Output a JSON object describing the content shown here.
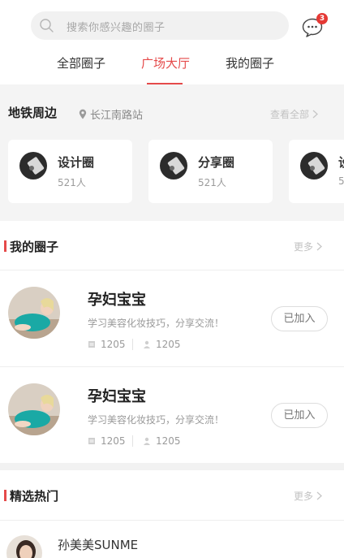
{
  "search": {
    "placeholder": "搜索你感兴趣的圈子"
  },
  "messages": {
    "badge_count": "3"
  },
  "tabs": [
    {
      "label": "全部圈子",
      "active": false
    },
    {
      "label": "广场大厅",
      "active": true
    },
    {
      "label": "我的圈子",
      "active": false
    }
  ],
  "nearby": {
    "title": "地铁周边",
    "location": "长江南路站",
    "more_label": "查看全部",
    "cards": [
      {
        "name": "设计圈",
        "count": "521人"
      },
      {
        "name": "分享圈",
        "count": "521人"
      },
      {
        "name": "设",
        "count": "5"
      }
    ]
  },
  "my_groups": {
    "title": "我的圈子",
    "more_label": "更多",
    "items": [
      {
        "name": "孕妇宝宝",
        "desc": "学习美容化妆技巧，分享交流！",
        "posts": "1205",
        "members": "1205",
        "button": "已加入"
      },
      {
        "name": "孕妇宝宝",
        "desc": "学习美容化妆技巧，分享交流！",
        "posts": "1205",
        "members": "1205",
        "button": "已加入"
      }
    ]
  },
  "hot": {
    "title": "精选热门",
    "more_label": "更多",
    "first_user": "孙美美SUNME"
  },
  "colors": {
    "accent": "#e54a4a",
    "badge": "#e53935"
  }
}
